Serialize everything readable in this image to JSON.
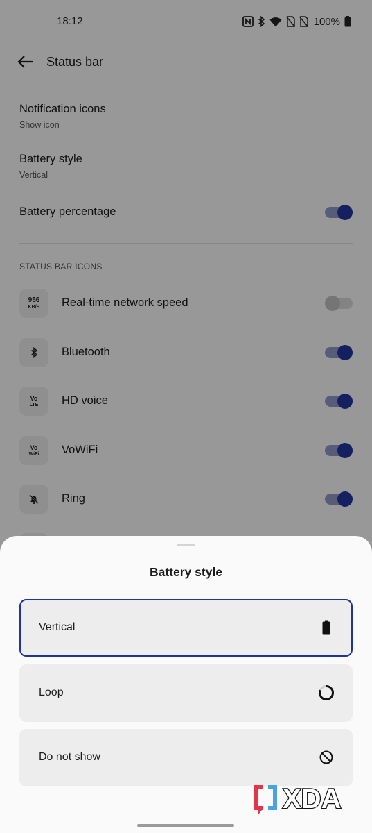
{
  "status_bar": {
    "time": "18:12",
    "battery_percent": "100%",
    "icons": [
      "nfc-icon",
      "bluetooth-icon",
      "wifi-icon",
      "no-sim-icon",
      "no-sim-icon",
      "battery-icon"
    ]
  },
  "header": {
    "title": "Status bar"
  },
  "settings": {
    "notification_icons": {
      "title": "Notification icons",
      "subtitle": "Show icon"
    },
    "battery_style": {
      "title": "Battery style",
      "subtitle": "Vertical"
    },
    "battery_percentage": {
      "title": "Battery percentage",
      "on": true
    }
  },
  "status_bar_icons": {
    "section_label": "STATUS BAR ICONS",
    "items": [
      {
        "label": "Real-time network speed",
        "icon": "network-speed-icon",
        "icon_text_top": "956",
        "icon_text_bottom": "KB/S",
        "on": false
      },
      {
        "label": "Bluetooth",
        "icon": "bluetooth-icon",
        "on": true
      },
      {
        "label": "HD voice",
        "icon": "volte-icon",
        "icon_text_top": "Vo",
        "icon_text_bottom": "LTE",
        "on": true
      },
      {
        "label": "VoWiFi",
        "icon": "vowifi-icon",
        "icon_text_top": "Vo",
        "icon_text_bottom": "WiFi",
        "on": true
      },
      {
        "label": "Ring",
        "icon": "bell-off-icon",
        "on": true
      }
    ]
  },
  "sheet": {
    "title": "Battery style",
    "options": [
      {
        "label": "Vertical",
        "icon": "battery-vertical-icon",
        "selected": true
      },
      {
        "label": "Loop",
        "icon": "battery-loop-icon",
        "selected": false
      },
      {
        "label": "Do not show",
        "icon": "do-not-show-icon",
        "selected": false
      }
    ]
  },
  "watermark": {
    "text": "XDA"
  },
  "colors": {
    "accent": "#21349b",
    "toggle_track_on": "#8d96c4",
    "scrim": "rgba(0,0,0,0.38)"
  }
}
